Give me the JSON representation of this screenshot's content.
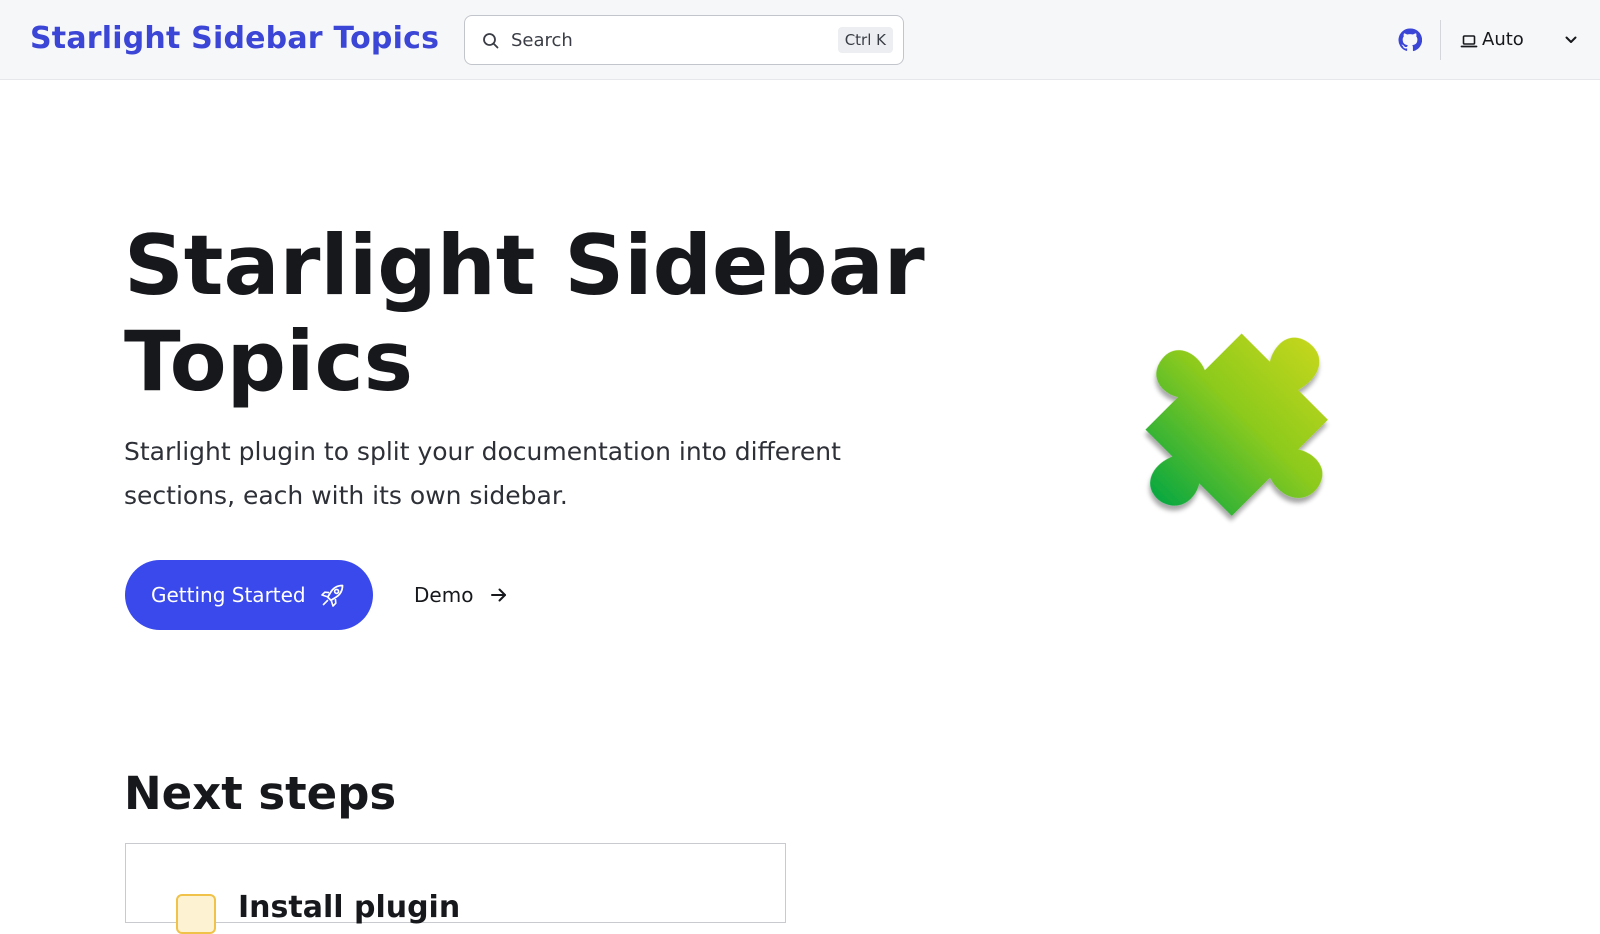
{
  "header": {
    "site_title": "Starlight Sidebar Topics",
    "search": {
      "placeholder": "Search",
      "shortcut": "Ctrl K"
    },
    "github_icon": "github-icon",
    "theme_select": {
      "icon": "laptop-icon",
      "value": "Auto",
      "chevron_icon": "chevron-down-icon"
    }
  },
  "hero": {
    "title": "Starlight Sidebar Topics",
    "tagline": "Starlight plugin to split your documentation into different sections, each with its own sidebar.",
    "actions": {
      "primary": {
        "label": "Getting Started",
        "icon": "rocket-icon",
        "color": "#3949ec"
      },
      "secondary": {
        "label": "Demo",
        "icon": "arrow-right-icon"
      }
    },
    "image": {
      "icon": "puzzle-piece-icon",
      "gradient_top": "#c2d61c",
      "gradient_bottom": "#0aa840"
    }
  },
  "next_steps": {
    "title": "Next steps",
    "cards": [
      {
        "title": "Install plugin",
        "icon": "setting-icon"
      }
    ]
  },
  "colors": {
    "accent": "#3b45d6",
    "header_bg": "#f6f7f9",
    "text": "#17181c"
  }
}
